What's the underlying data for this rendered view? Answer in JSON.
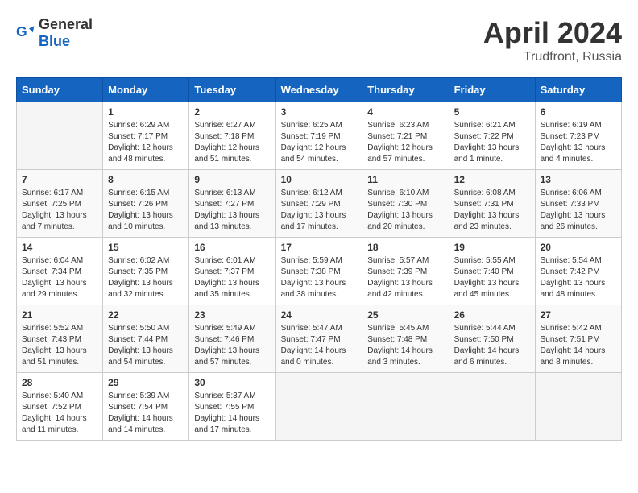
{
  "header": {
    "logo_general": "General",
    "logo_blue": "Blue",
    "title": "April 2024",
    "location": "Trudfront, Russia"
  },
  "weekdays": [
    "Sunday",
    "Monday",
    "Tuesday",
    "Wednesday",
    "Thursday",
    "Friday",
    "Saturday"
  ],
  "weeks": [
    [
      {
        "day": "",
        "info": ""
      },
      {
        "day": "1",
        "info": "Sunrise: 6:29 AM\nSunset: 7:17 PM\nDaylight: 12 hours\nand 48 minutes."
      },
      {
        "day": "2",
        "info": "Sunrise: 6:27 AM\nSunset: 7:18 PM\nDaylight: 12 hours\nand 51 minutes."
      },
      {
        "day": "3",
        "info": "Sunrise: 6:25 AM\nSunset: 7:19 PM\nDaylight: 12 hours\nand 54 minutes."
      },
      {
        "day": "4",
        "info": "Sunrise: 6:23 AM\nSunset: 7:21 PM\nDaylight: 12 hours\nand 57 minutes."
      },
      {
        "day": "5",
        "info": "Sunrise: 6:21 AM\nSunset: 7:22 PM\nDaylight: 13 hours\nand 1 minute."
      },
      {
        "day": "6",
        "info": "Sunrise: 6:19 AM\nSunset: 7:23 PM\nDaylight: 13 hours\nand 4 minutes."
      }
    ],
    [
      {
        "day": "7",
        "info": "Sunrise: 6:17 AM\nSunset: 7:25 PM\nDaylight: 13 hours\nand 7 minutes."
      },
      {
        "day": "8",
        "info": "Sunrise: 6:15 AM\nSunset: 7:26 PM\nDaylight: 13 hours\nand 10 minutes."
      },
      {
        "day": "9",
        "info": "Sunrise: 6:13 AM\nSunset: 7:27 PM\nDaylight: 13 hours\nand 13 minutes."
      },
      {
        "day": "10",
        "info": "Sunrise: 6:12 AM\nSunset: 7:29 PM\nDaylight: 13 hours\nand 17 minutes."
      },
      {
        "day": "11",
        "info": "Sunrise: 6:10 AM\nSunset: 7:30 PM\nDaylight: 13 hours\nand 20 minutes."
      },
      {
        "day": "12",
        "info": "Sunrise: 6:08 AM\nSunset: 7:31 PM\nDaylight: 13 hours\nand 23 minutes."
      },
      {
        "day": "13",
        "info": "Sunrise: 6:06 AM\nSunset: 7:33 PM\nDaylight: 13 hours\nand 26 minutes."
      }
    ],
    [
      {
        "day": "14",
        "info": "Sunrise: 6:04 AM\nSunset: 7:34 PM\nDaylight: 13 hours\nand 29 minutes."
      },
      {
        "day": "15",
        "info": "Sunrise: 6:02 AM\nSunset: 7:35 PM\nDaylight: 13 hours\nand 32 minutes."
      },
      {
        "day": "16",
        "info": "Sunrise: 6:01 AM\nSunset: 7:37 PM\nDaylight: 13 hours\nand 35 minutes."
      },
      {
        "day": "17",
        "info": "Sunrise: 5:59 AM\nSunset: 7:38 PM\nDaylight: 13 hours\nand 38 minutes."
      },
      {
        "day": "18",
        "info": "Sunrise: 5:57 AM\nSunset: 7:39 PM\nDaylight: 13 hours\nand 42 minutes."
      },
      {
        "day": "19",
        "info": "Sunrise: 5:55 AM\nSunset: 7:40 PM\nDaylight: 13 hours\nand 45 minutes."
      },
      {
        "day": "20",
        "info": "Sunrise: 5:54 AM\nSunset: 7:42 PM\nDaylight: 13 hours\nand 48 minutes."
      }
    ],
    [
      {
        "day": "21",
        "info": "Sunrise: 5:52 AM\nSunset: 7:43 PM\nDaylight: 13 hours\nand 51 minutes."
      },
      {
        "day": "22",
        "info": "Sunrise: 5:50 AM\nSunset: 7:44 PM\nDaylight: 13 hours\nand 54 minutes."
      },
      {
        "day": "23",
        "info": "Sunrise: 5:49 AM\nSunset: 7:46 PM\nDaylight: 13 hours\nand 57 minutes."
      },
      {
        "day": "24",
        "info": "Sunrise: 5:47 AM\nSunset: 7:47 PM\nDaylight: 14 hours\nand 0 minutes."
      },
      {
        "day": "25",
        "info": "Sunrise: 5:45 AM\nSunset: 7:48 PM\nDaylight: 14 hours\nand 3 minutes."
      },
      {
        "day": "26",
        "info": "Sunrise: 5:44 AM\nSunset: 7:50 PM\nDaylight: 14 hours\nand 6 minutes."
      },
      {
        "day": "27",
        "info": "Sunrise: 5:42 AM\nSunset: 7:51 PM\nDaylight: 14 hours\nand 8 minutes."
      }
    ],
    [
      {
        "day": "28",
        "info": "Sunrise: 5:40 AM\nSunset: 7:52 PM\nDaylight: 14 hours\nand 11 minutes."
      },
      {
        "day": "29",
        "info": "Sunrise: 5:39 AM\nSunset: 7:54 PM\nDaylight: 14 hours\nand 14 minutes."
      },
      {
        "day": "30",
        "info": "Sunrise: 5:37 AM\nSunset: 7:55 PM\nDaylight: 14 hours\nand 17 minutes."
      },
      {
        "day": "",
        "info": ""
      },
      {
        "day": "",
        "info": ""
      },
      {
        "day": "",
        "info": ""
      },
      {
        "day": "",
        "info": ""
      }
    ]
  ]
}
